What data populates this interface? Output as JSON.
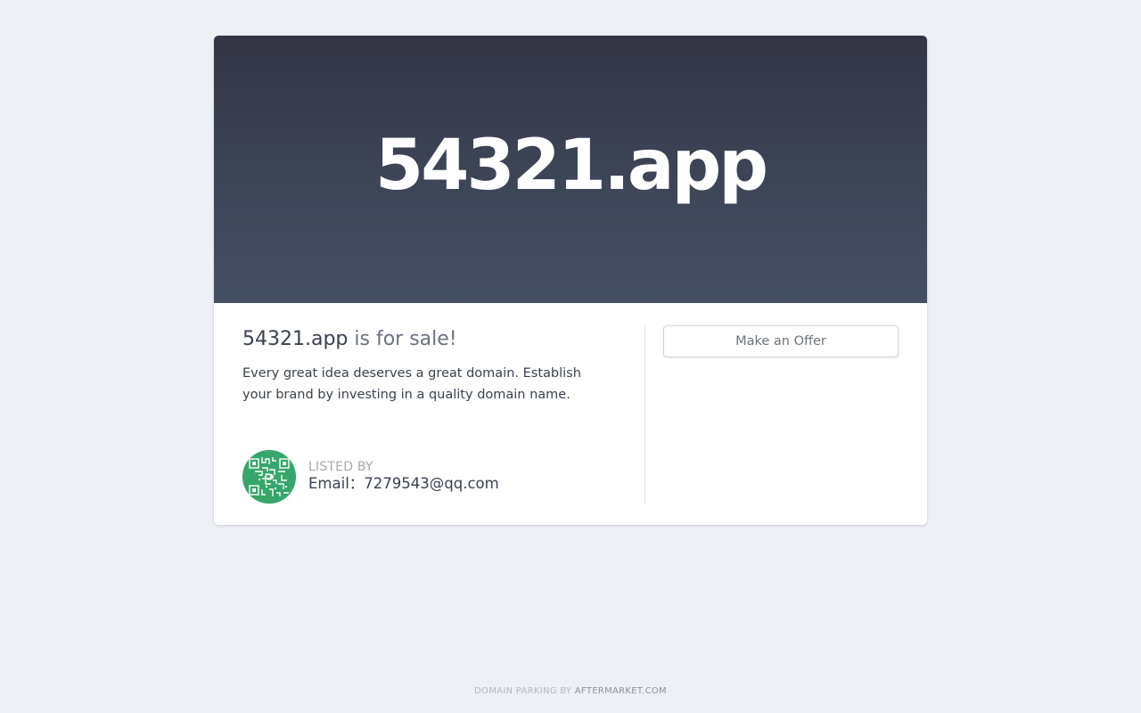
{
  "hero": {
    "domain": "54321.app"
  },
  "sale": {
    "domain": "54321.app",
    "suffix": " is for sale!",
    "tagline": "Every great idea deserves a great domain. Establish your brand by investing in a quality domain name."
  },
  "offer": {
    "button_label": "Make an Offer"
  },
  "lister": {
    "heading": "LISTED BY",
    "contact": "Email：7279543@qq.com",
    "avatar_icon": "qr-code-avatar-icon"
  },
  "footer": {
    "prefix": "DOMAIN PARKING BY ",
    "brand": "AFTERMARKET.COM"
  },
  "colors": {
    "background": "#edf0f5",
    "hero_top": "#333545",
    "hero_bottom": "#454f62",
    "avatar_green": "#36a76a"
  }
}
